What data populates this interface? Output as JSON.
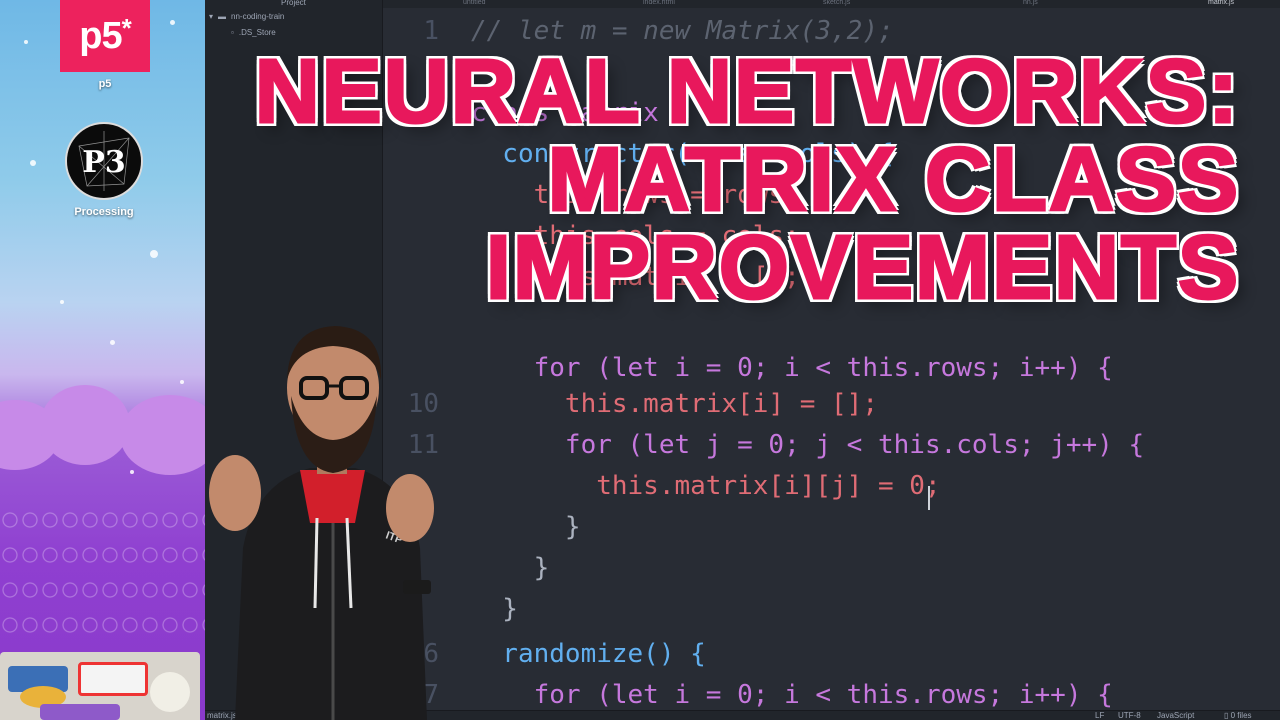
{
  "desktop": {
    "apps": [
      {
        "logo_text": "p5",
        "logo_mark": "*",
        "label": "p5"
      },
      {
        "logo_text": "P3",
        "label": "Processing"
      }
    ]
  },
  "editor": {
    "tree": {
      "header": "Project",
      "root": "nn-coding-train",
      "files": [
        ".DS_Store"
      ]
    },
    "tabs": [
      "untitled",
      "index.html",
      "sketch.js",
      "nn.js",
      "matrix.js"
    ],
    "code_lines": [
      {
        "num": "1",
        "text": "// let m = new Matrix(3,2);"
      },
      {
        "num": "",
        "text": ""
      },
      {
        "num": "",
        "text": "class Matrix {"
      },
      {
        "num": "",
        "text": "  constructor(rows, cols) {"
      },
      {
        "num": "",
        "text": "    this.rows = rows;"
      },
      {
        "num": "",
        "text": "    this.cols = cols;"
      },
      {
        "num": "",
        "text": "    this.matrix = [];"
      },
      {
        "num": "",
        "text": ""
      },
      {
        "num": "",
        "text": "    for (let i = 0; i < this.rows; i++) {"
      },
      {
        "num": "10",
        "text": "      this.matrix[i] = [];"
      },
      {
        "num": "11",
        "text": "      for (let j = 0; j < this.cols; j++) {"
      },
      {
        "num": "",
        "text": "        this.matrix[i][j] = 0;"
      },
      {
        "num": "",
        "text": "      }"
      },
      {
        "num": "",
        "text": "    }"
      },
      {
        "num": "",
        "text": "  }"
      },
      {
        "num": "",
        "text": ""
      },
      {
        "num": "6",
        "text": "  randomize() {"
      },
      {
        "num": "7",
        "text": "    for (let i = 0; i < this.rows; i++) {"
      }
    ],
    "status": {
      "file": "matrix.js",
      "line_ending": "LF",
      "encoding": "UTF-8",
      "grammar": "JavaScript",
      "files": "0 files"
    }
  },
  "title_overlay": {
    "lines": [
      "NEURAL NETWORKS:",
      "MATRIX CLASS",
      "IMPROVEMENTS"
    ],
    "color": "#e8185c",
    "outline": "#ffffff"
  },
  "colors": {
    "p5_brand": "#ed225d",
    "editor_bg": "#282c34",
    "keyword": "#c678dd",
    "property": "#e06c75",
    "function": "#61afef",
    "number": "#d19a66"
  }
}
